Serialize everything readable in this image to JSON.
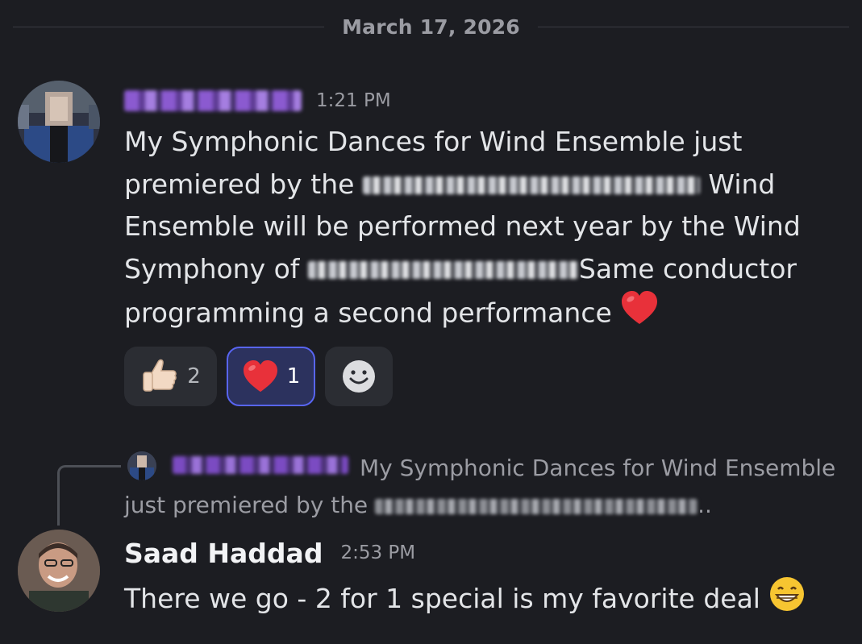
{
  "date_divider": "March 17, 2026",
  "message1": {
    "author_redacted": true,
    "time": "1:21 PM",
    "text_part1": "My Symphonic Dances for Wind Ensemble just premiered by the",
    "text_part2": "Wind Ensemble will be performed next year by the Wind Symphony of",
    "text_part3": "Same conductor programming a second performance",
    "emoji": "❤️"
  },
  "reactions": [
    {
      "emoji": "👍🏻",
      "count": "2",
      "active": false
    },
    {
      "emoji": "❤️",
      "count": "1",
      "active": true
    },
    {
      "emoji": "add-reaction-icon",
      "count": "",
      "active": false
    }
  ],
  "reply_preview": {
    "author_redacted": true,
    "text": "My Symphonic Dances for Wind Ensemble just premiered by the",
    "suffix": ".."
  },
  "message2": {
    "author": "Saad Haddad",
    "time": "2:53 PM",
    "text": "There we go - 2 for 1 special is my favorite deal",
    "emoji": "😁"
  },
  "colors": {
    "background": "#1c1d22",
    "reaction_bg": "#2b2d33",
    "active_reaction_border": "#5865f2",
    "redacted_name": "#8b5ad0"
  }
}
